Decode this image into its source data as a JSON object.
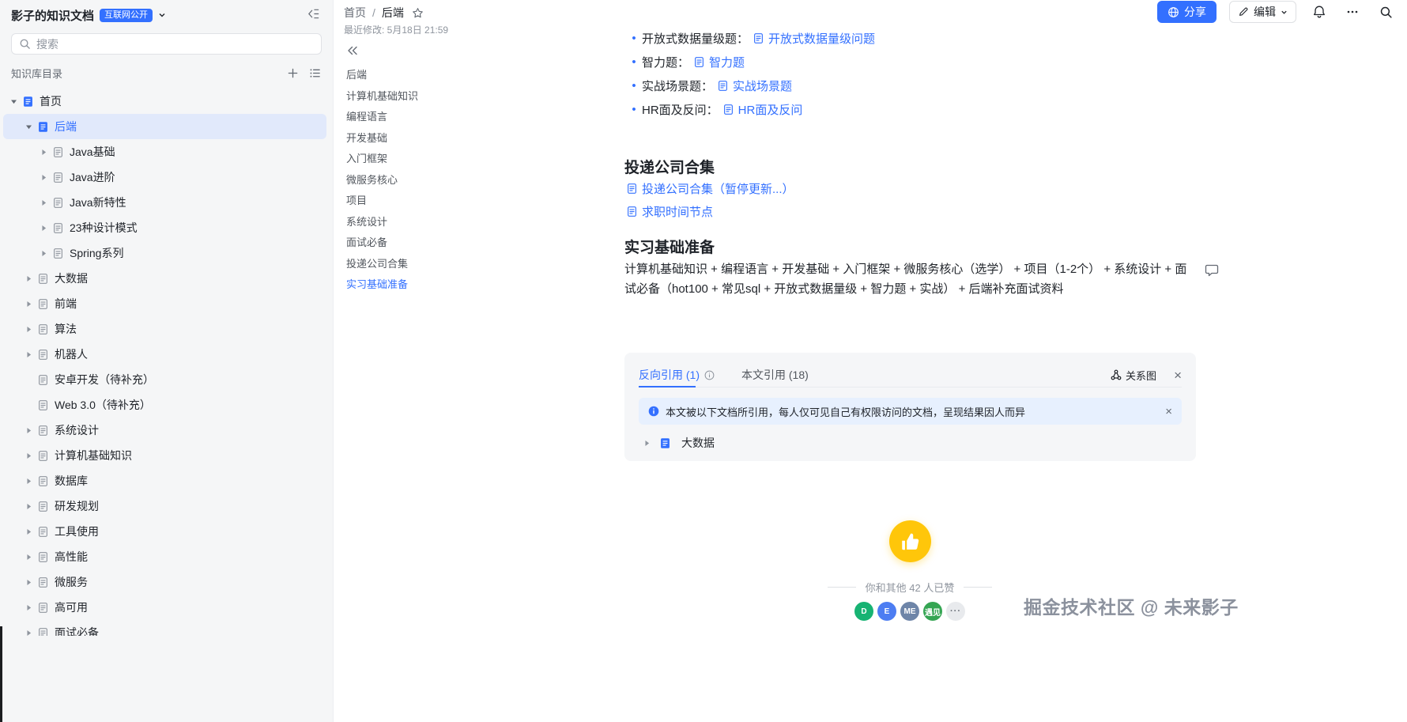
{
  "app": {
    "accent_color": "#3370ff",
    "like_color": "#ffc60a"
  },
  "icons": {
    "close": "×",
    "bullet": "•"
  },
  "sidebar": {
    "title": "影子的知识文档",
    "badge": "互联网公开",
    "search": {
      "placeholder": "搜索"
    },
    "directory_label": "知识库目录",
    "tree": [
      {
        "label": "首页",
        "level": 0,
        "arrow": "down",
        "icon": "filled"
      },
      {
        "label": "后端",
        "level": 1,
        "arrow": "down",
        "icon": "filled",
        "selected": true
      },
      {
        "label": "Java基础",
        "level": 2,
        "arrow": "right",
        "icon": "outline"
      },
      {
        "label": "Java进阶",
        "level": 2,
        "arrow": "right",
        "icon": "outline"
      },
      {
        "label": "Java新特性",
        "level": 2,
        "arrow": "right",
        "icon": "outline"
      },
      {
        "label": "23种设计模式",
        "level": 2,
        "arrow": "right",
        "icon": "outline"
      },
      {
        "label": "Spring系列",
        "level": 2,
        "arrow": "right",
        "icon": "outline"
      },
      {
        "label": "大数据",
        "level": 1,
        "arrow": "right",
        "icon": "outline"
      },
      {
        "label": "前端",
        "level": 1,
        "arrow": "right",
        "icon": "outline"
      },
      {
        "label": "算法",
        "level": 1,
        "arrow": "right",
        "icon": "outline"
      },
      {
        "label": "机器人",
        "level": 1,
        "arrow": "right",
        "icon": "outline"
      },
      {
        "label": "安卓开发（待补充）",
        "level": 1,
        "arrow": "none",
        "icon": "outline"
      },
      {
        "label": "Web 3.0（待补充）",
        "level": 1,
        "arrow": "none",
        "icon": "outline"
      },
      {
        "label": "系统设计",
        "level": 1,
        "arrow": "right",
        "icon": "outline"
      },
      {
        "label": "计算机基础知识",
        "level": 1,
        "arrow": "right",
        "icon": "outline"
      },
      {
        "label": "数据库",
        "level": 1,
        "arrow": "right",
        "icon": "outline"
      },
      {
        "label": "研发规划",
        "level": 1,
        "arrow": "right",
        "icon": "outline"
      },
      {
        "label": "工具使用",
        "level": 1,
        "arrow": "right",
        "icon": "outline"
      },
      {
        "label": "高性能",
        "level": 1,
        "arrow": "right",
        "icon": "outline"
      },
      {
        "label": "微服务",
        "level": 1,
        "arrow": "right",
        "icon": "outline"
      },
      {
        "label": "高可用",
        "level": 1,
        "arrow": "right",
        "icon": "outline"
      },
      {
        "label": "面试必备",
        "level": 1,
        "arrow": "right",
        "icon": "outline",
        "partial": true
      }
    ]
  },
  "header": {
    "breadcrumb": {
      "root": "首页",
      "separator": "/",
      "current": "后端"
    },
    "modified": "最近修改: 5月18日 21:59",
    "share_label": "分享",
    "edit_label": "编辑"
  },
  "toc": {
    "items": [
      "后端",
      "计算机基础知识",
      "编程语言",
      "开发基础",
      "入门框架",
      "微服务核心",
      "项目",
      "系统设计",
      "面试必备",
      "投递公司合集",
      "实习基础准备"
    ],
    "active_index": 10
  },
  "content": {
    "bullets": [
      {
        "label": "开放式数据量级题：",
        "link": "开放式数据量级问题"
      },
      {
        "label": "智力题：",
        "link": "智力题"
      },
      {
        "label": "实战场景题：",
        "link": "实战场景题"
      },
      {
        "label": "HR面及反问：",
        "link": "HR面及反问"
      }
    ],
    "section_company": {
      "title": "投递公司合集",
      "links": [
        "投递公司合集（暂停更新...）",
        "求职时间节点"
      ]
    },
    "section_intern": {
      "title": "实习基础准备",
      "body": "计算机基础知识 + 编程语言 + 开发基础 + 入门框架 + 微服务核心（选学） + 项目（1-2个） + 系统设计 + 面试必备（hot100 + 常见sql + 开放式数据量级 + 智力题 + 实战） + 后端补充面试资料"
    }
  },
  "backlinks": {
    "tab_backward": "反向引用 (1)",
    "tab_forward": "本文引用 (18)",
    "graph_label": "关系图",
    "notice": "本文被以下文档所引用，每人仅可见自己有权限访问的文档，呈现结果因人而异",
    "items": [
      {
        "label": "大数据"
      }
    ]
  },
  "likes": {
    "count_text": "你和其他 42 人已赞",
    "avatars": [
      {
        "text": "D",
        "color": "#17b373"
      },
      {
        "text": "E",
        "color": "#4d7df2"
      },
      {
        "text": "ME",
        "color": "#6e85a8"
      },
      {
        "text": "遇见",
        "color": "#35a553"
      },
      {
        "text": "···",
        "color": "#e8eaed",
        "kind": "more"
      }
    ]
  },
  "watermark": "掘金技术社区 @ 未来影子"
}
